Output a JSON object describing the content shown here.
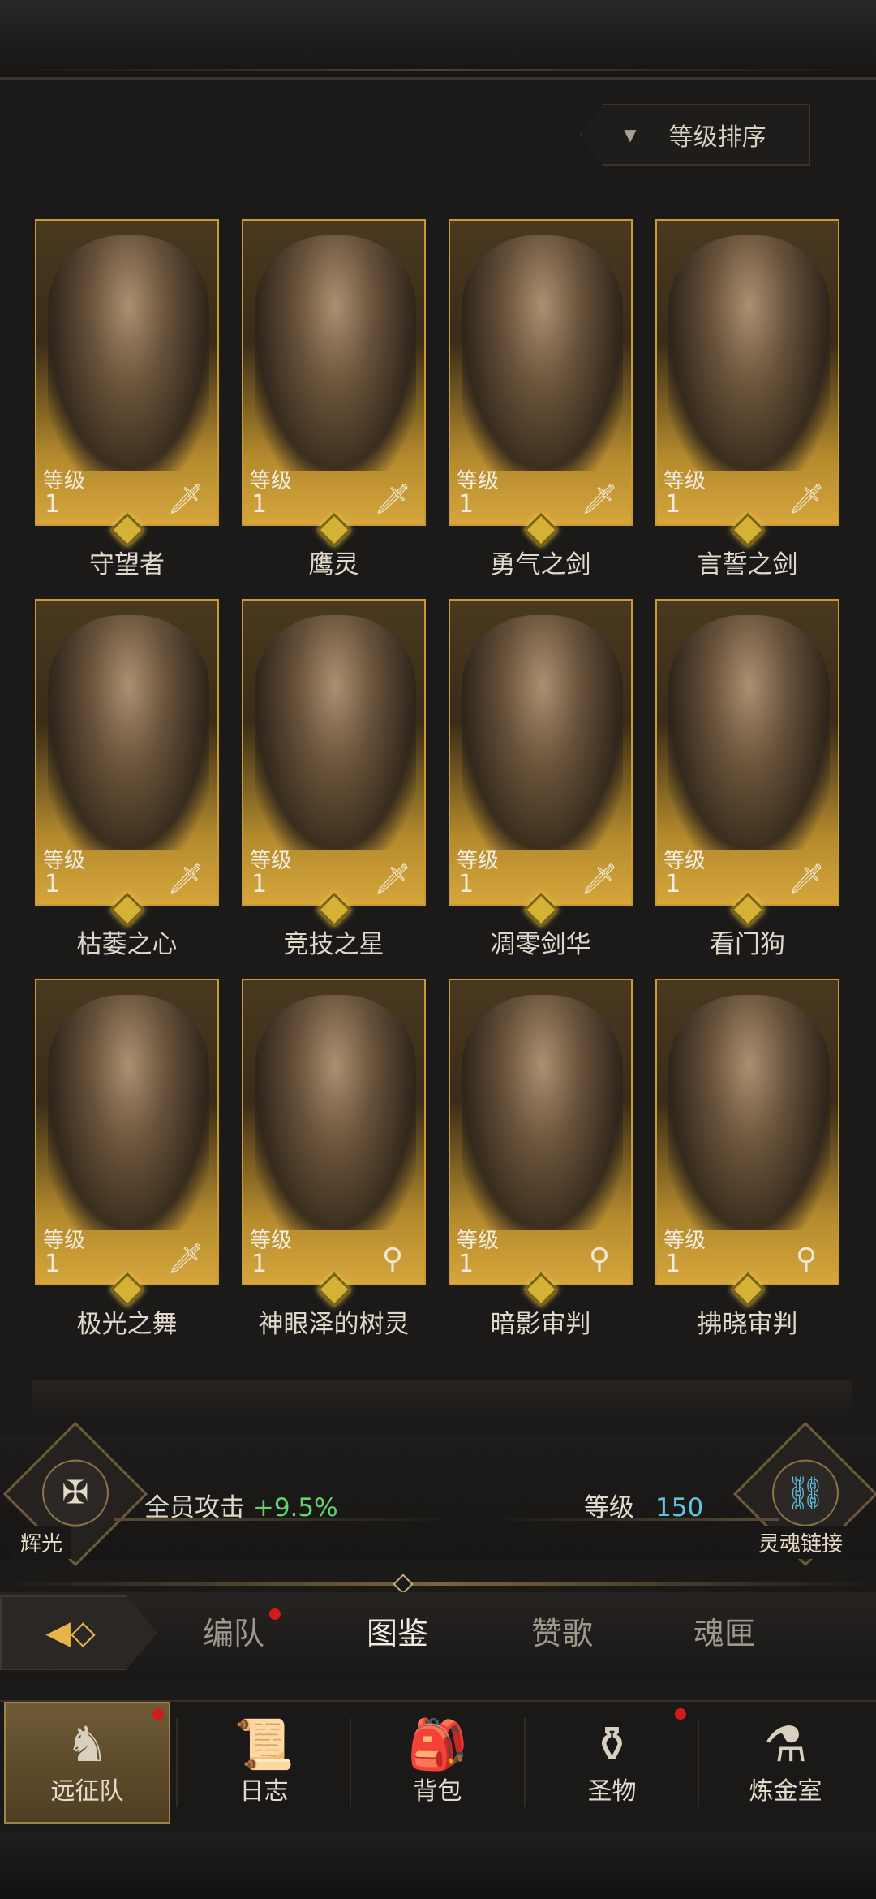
{
  "sort": {
    "label": "等级排序",
    "icon": "triangle-down-icon"
  },
  "level_label": "等级",
  "heroes": [
    {
      "name": "守望者",
      "level": "1",
      "weapon": "sword-icon",
      "weapon_glyph": "🗡"
    },
    {
      "name": "鹰灵",
      "level": "1",
      "weapon": "sword-icon",
      "weapon_glyph": "🗡"
    },
    {
      "name": "勇气之剑",
      "level": "1",
      "weapon": "sword-icon",
      "weapon_glyph": "🗡"
    },
    {
      "name": "言誓之剑",
      "level": "1",
      "weapon": "sword-icon",
      "weapon_glyph": "🗡"
    },
    {
      "name": "枯萎之心",
      "level": "1",
      "weapon": "sword-icon",
      "weapon_glyph": "🗡"
    },
    {
      "name": "竞技之星",
      "level": "1",
      "weapon": "sword-icon",
      "weapon_glyph": "🗡"
    },
    {
      "name": "凋零剑华",
      "level": "1",
      "weapon": "sword-icon",
      "weapon_glyph": "🗡"
    },
    {
      "name": "看门狗",
      "level": "1",
      "weapon": "sword-icon",
      "weapon_glyph": "🗡"
    },
    {
      "name": "极光之舞",
      "level": "1",
      "weapon": "sword-icon",
      "weapon_glyph": "🗡"
    },
    {
      "name": "神眼泽的树灵",
      "level": "1",
      "weapon": "staff-icon",
      "weapon_glyph": "⚲"
    },
    {
      "name": "暗影审判",
      "level": "1",
      "weapon": "staff-icon",
      "weapon_glyph": "⚲"
    },
    {
      "name": "拂晓审判",
      "level": "1",
      "weapon": "staff-icon",
      "weapon_glyph": "⚲"
    }
  ],
  "bonus": {
    "left_emblem_label": "辉光",
    "left_emblem_icon": "radiance-icon",
    "text": "全员攻击",
    "value": "+9.5%",
    "level_label": "等级",
    "level_value": "150",
    "right_emblem_label": "灵魂链接",
    "right_emblem_icon": "soul-link-icon",
    "value_color": "#63d36b",
    "level_color": "#63c2e0"
  },
  "tabs": [
    {
      "label": "编队",
      "active": false,
      "dot": true
    },
    {
      "label": "图鉴",
      "active": true,
      "dot": false
    },
    {
      "label": "赞歌",
      "active": false,
      "dot": false
    },
    {
      "label": "魂匣",
      "active": false,
      "dot": false
    }
  ],
  "bottom_nav": [
    {
      "label": "远征队",
      "icon": "horned-helmet-icon",
      "glyph": "♞",
      "active": true,
      "dot": true
    },
    {
      "label": "日志",
      "icon": "scroll-icon",
      "glyph": "📜",
      "active": false,
      "dot": false
    },
    {
      "label": "背包",
      "icon": "backpack-icon",
      "glyph": "🎒",
      "active": false,
      "dot": false
    },
    {
      "label": "圣物",
      "icon": "relic-icon",
      "glyph": "⚱",
      "active": false,
      "dot": true
    },
    {
      "label": "炼金室",
      "icon": "alchemy-icon",
      "glyph": "⚗",
      "active": false,
      "dot": false
    }
  ],
  "colors": {
    "accent_gold": "#c89b33",
    "notification_red": "#d21c1c"
  }
}
